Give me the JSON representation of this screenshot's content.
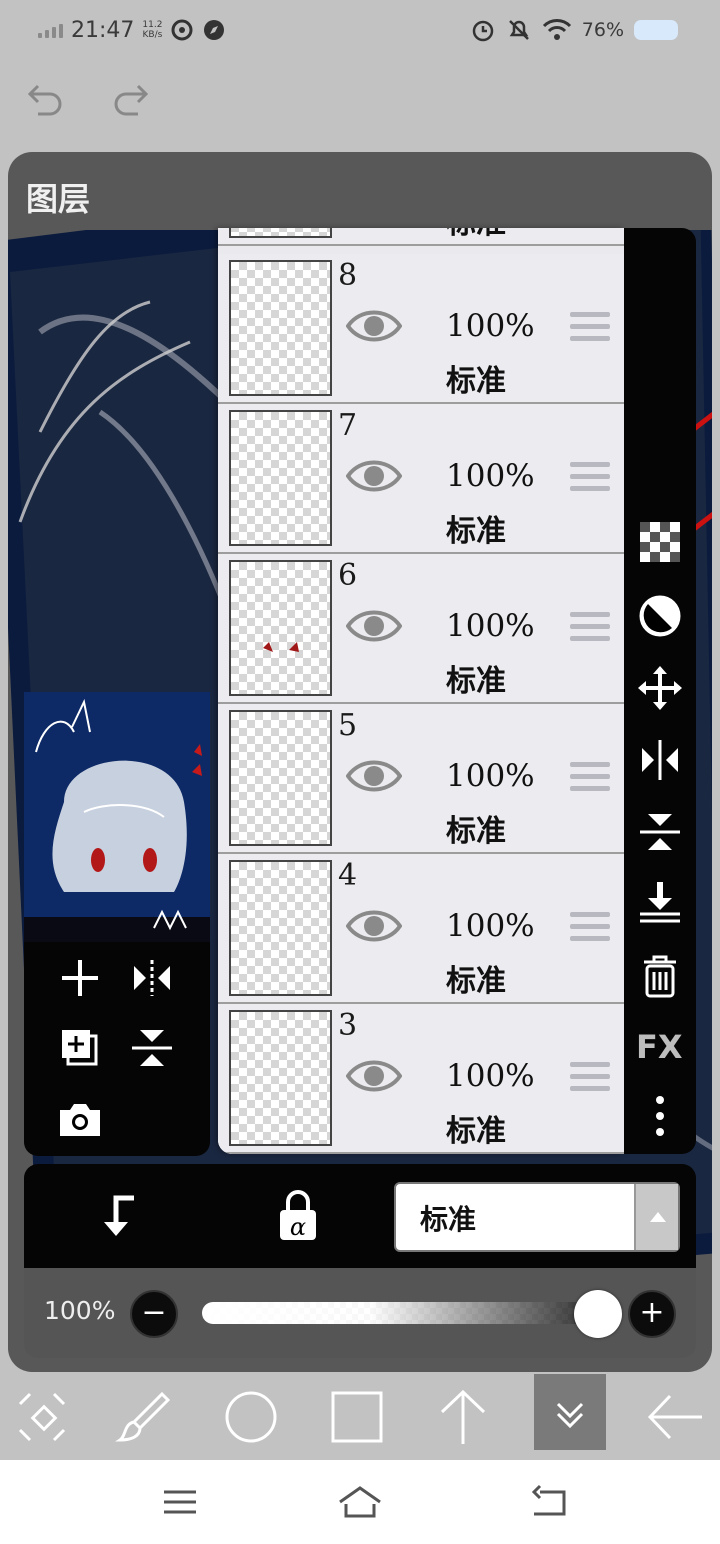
{
  "status_bar": {
    "time": "21:47",
    "net_speed_value": "11.2",
    "net_speed_unit": "KB/s",
    "battery_text": "76%",
    "icons": [
      "signal-icon",
      "sync-icon",
      "compass-icon",
      "alarm-icon",
      "mute-icon",
      "wifi-icon",
      "battery-icon"
    ]
  },
  "top_actions": {
    "undo": "undo-icon",
    "redo": "redo-icon"
  },
  "dialog": {
    "title": "图层"
  },
  "layers": [
    {
      "number": "",
      "opacity": "",
      "mode": "标准",
      "visible": true
    },
    {
      "number": "8",
      "opacity": "100%",
      "mode": "标准",
      "visible": true
    },
    {
      "number": "7",
      "opacity": "100%",
      "mode": "标准",
      "visible": true
    },
    {
      "number": "6",
      "opacity": "100%",
      "mode": "标准",
      "visible": true
    },
    {
      "number": "5",
      "opacity": "100%",
      "mode": "标准",
      "visible": true
    },
    {
      "number": "4",
      "opacity": "100%",
      "mode": "标准",
      "visible": true
    },
    {
      "number": "3",
      "opacity": "100%",
      "mode": "标准",
      "visible": true
    }
  ],
  "left_tools": [
    "add-layer-icon",
    "flip-horizontal-icon",
    "duplicate-layer-icon",
    "flip-vertical-icon",
    "camera-icon"
  ],
  "right_tools": [
    "transparency-icon",
    "contrast-icon",
    "move-icon",
    "flip-h-icon",
    "flip-v-icon",
    "merge-down-icon",
    "delete-icon",
    "fx-icon",
    "more-icon"
  ],
  "fx_label": "FX",
  "layer_bottom": {
    "clip_icon": "clip-arrow-icon",
    "alpha_lock_icon": "alpha-lock-icon",
    "blend_mode": "标准"
  },
  "opacity": {
    "label": "100%",
    "minus": "−",
    "plus": "+",
    "value": 1.0
  },
  "bottom_toolbar": [
    "transform-icon",
    "brush-icon",
    "ellipse-icon",
    "rectangle-icon",
    "up-arrow-icon",
    "collapse-icon",
    "back-arrow-icon"
  ],
  "nav_bar": [
    "menu-icon",
    "home-icon",
    "back-icon"
  ]
}
